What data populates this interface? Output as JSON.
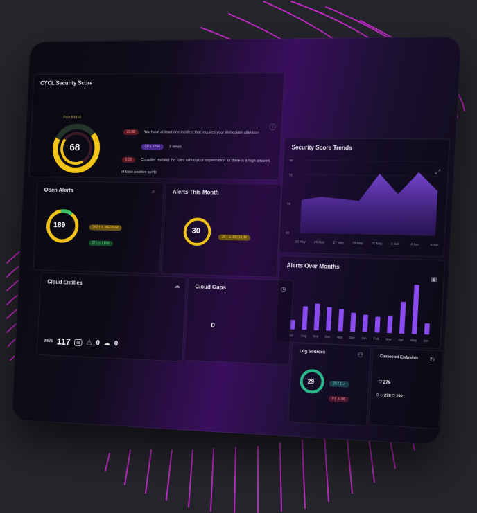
{
  "security_score": {
    "title": "CYCL Security Score",
    "score": "68",
    "ring_label": "Poor 68/100",
    "alerts": [
      {
        "badge": "23.88",
        "text": "You have at least one incident that requires your immediate attention",
        "tag": "CPS 9744",
        "meta": "3 views"
      },
      {
        "badge": "9.28",
        "text": "Consider revising the rules within your organization as there is a high amount of false positive alerts"
      }
    ],
    "colors": {
      "good": "#f2c417",
      "bad": "#2a3a2e"
    }
  },
  "trends": {
    "title": "Security Score Trends",
    "chart_data": {
      "type": "area",
      "categories": [
        "23 May",
        "25 May",
        "27 May",
        "29 May",
        "31 May",
        "2 Jun",
        "4 Jun",
        "6 Jun"
      ],
      "values": [
        58,
        60,
        59,
        58,
        73,
        62,
        74,
        64
      ],
      "yticks": [
        "80",
        "72",
        "56",
        "40"
      ],
      "ylim": [
        40,
        80
      ]
    }
  },
  "open_alerts": {
    "title": "Open Alerts",
    "count": "189",
    "medium": "162 | ⚠ MEDIUM",
    "low": "27 | ⚠ LOW"
  },
  "alerts_month": {
    "title": "Alerts This Month",
    "count": "30",
    "medium": "30 | ⚠ MEDIUM"
  },
  "alerts_over_months": {
    "title": "Alerts Over Months",
    "chart_data": {
      "type": "bar",
      "categories": [
        "Jul",
        "Aug",
        "Sep",
        "Oct",
        "Nov",
        "Dec",
        "Jan",
        "Feb",
        "Mar",
        "Apr",
        "May",
        "Jun"
      ],
      "values": [
        12,
        30,
        34,
        30,
        28,
        24,
        22,
        20,
        22,
        40,
        62,
        14
      ]
    }
  },
  "cloud_entities": {
    "title": "Cloud Entities",
    "aws_label": "aws",
    "aws_count": "117",
    "other_counts": [
      "0",
      "0"
    ]
  },
  "cloud_gaps": {
    "title": "Cloud Gaps",
    "count": "0"
  },
  "log_sources": {
    "title": "Log Sources",
    "count": "29",
    "b1": "29 | 1 ✓",
    "b2": "0 | ⚠ 96"
  },
  "endpoints": {
    "title": "Connected Endpoints",
    "total": "279",
    "win": "278",
    "other": "292",
    "zero": "0"
  }
}
